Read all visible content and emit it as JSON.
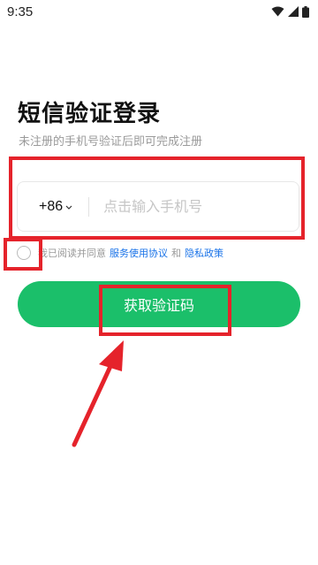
{
  "status_bar": {
    "time": "9:35",
    "icons": [
      "wifi-icon",
      "signal-icon",
      "battery-icon"
    ]
  },
  "login": {
    "title": "短信验证登录",
    "subtitle": "未注册的手机号验证后即可完成注册",
    "country_code": "+86",
    "phone_placeholder": "点击输入手机号",
    "agreement": {
      "prefix": "我已阅读并同意",
      "service_link": "服务使用协议",
      "and": "和",
      "privacy_link": "隐私政策"
    },
    "cta_label": "获取验证码"
  },
  "colors": {
    "accent_green": "#1bbf6a",
    "link_blue": "#1a73e8",
    "annotation_red": "#e5232b"
  }
}
